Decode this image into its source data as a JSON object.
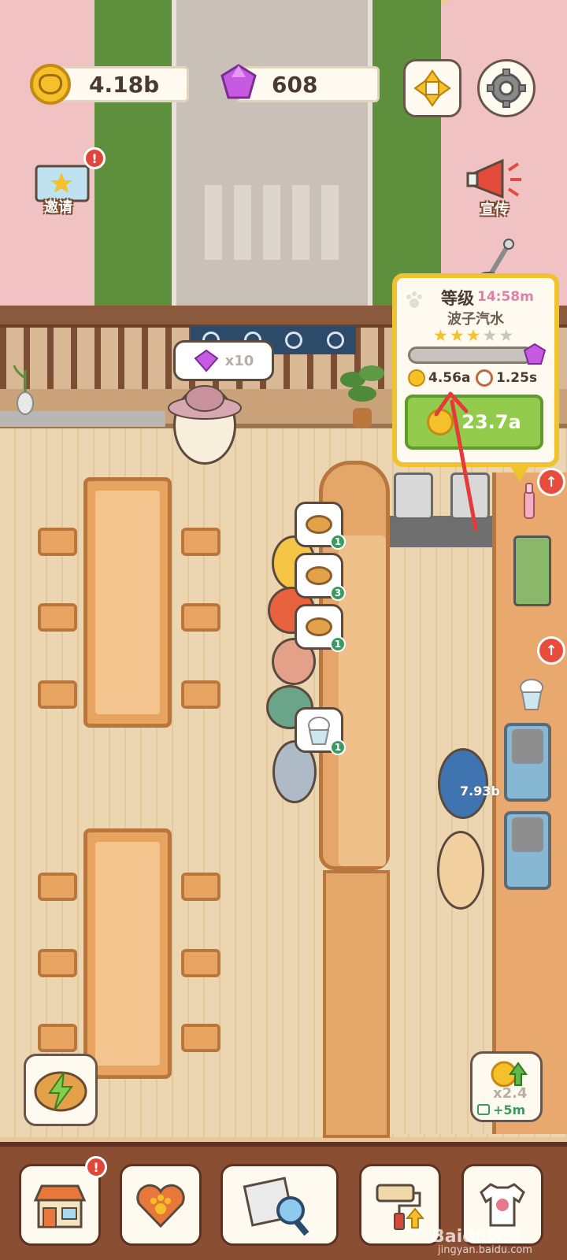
{
  "hud": {
    "coins": "4.18b",
    "gems": "608"
  },
  "side": {
    "invite_label": "邀请",
    "invite_badge": "!",
    "promote_label": "宣传"
  },
  "gem_reward": {
    "text": "x10"
  },
  "popup": {
    "title": "等级",
    "timer": "14:58m",
    "item_name": "波子汽水",
    "stars_filled": 3,
    "stars_total": 5,
    "stars": [
      "★",
      "★",
      "★",
      "★",
      "★"
    ],
    "level_progress": 0.0,
    "income": "4.56a",
    "interval": "1.25s",
    "upgrade_cost": "23.7a"
  },
  "orders": [
    {
      "count": "1"
    },
    {
      "count": "3"
    },
    {
      "count": "1"
    },
    {
      "count": "1"
    }
  ],
  "upgrade_markers": [
    "↑",
    "↑"
  ],
  "customer_coin": "7.93b",
  "multiplier": {
    "value": "x2.4",
    "duration": "+5m"
  },
  "bottom_nav": [
    {
      "icon": "shop-icon",
      "badge": "!"
    },
    {
      "icon": "heart-paw-icon"
    },
    {
      "icon": "newspaper-search-icon"
    },
    {
      "icon": "paint-roller-icon"
    },
    {
      "icon": "tshirt-icon"
    }
  ],
  "watermark": {
    "main": "Baidu经验",
    "sub": "jingyan.baidu.com"
  },
  "colors": {
    "popup_border": "#f0c22e",
    "upgrade_button": "#93cc4c",
    "annotation_arrow": "#e63a3a"
  }
}
